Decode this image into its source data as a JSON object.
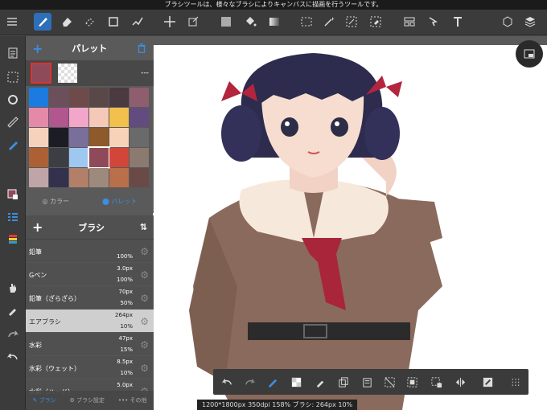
{
  "tooltip": "ブラシツールは、様々なブラシによりキャンバスに描画を行うツールです。",
  "palette": {
    "title": "パレット",
    "current_value": "---",
    "tabs": [
      "カラー",
      "パレット"
    ],
    "swatches": [
      "#1b7be0",
      "#6b4f5a",
      "#6e4a4a",
      "#5a4747",
      "#4b3a3f",
      "#8f5e6e",
      "#e589a8",
      "#b1568e",
      "#f2a6c9",
      "#f5c9b7",
      "#f2c04c",
      "#624b7f",
      "#f6d2bd",
      "#1c1c24",
      "#7a6e9a",
      "#8e5a2c",
      "#f7d2b8",
      "#6a6a6a",
      "#ad6036",
      "#3d3d44",
      "#9ec8f0",
      "#8f4a5a",
      "#d2463a",
      "#8a7a70",
      "#bfa4a8",
      "#33314e",
      "#b28068",
      "#9e8a7c",
      "#b86f4a",
      "#6a4a47"
    ],
    "current_color": "#8f4a5a"
  },
  "brush": {
    "title": "ブラシ",
    "items": [
      {
        "name": "鉛筆",
        "size": "",
        "opacity": "100%"
      },
      {
        "name": "Gペン",
        "size": "3.0px",
        "opacity": "100%"
      },
      {
        "name": "鉛筆（ざらざら）",
        "size": "70px",
        "opacity": "50%"
      },
      {
        "name": "エアブラシ",
        "size": "264px",
        "opacity": "10%"
      },
      {
        "name": "水彩",
        "size": "47px",
        "opacity": "15%"
      },
      {
        "name": "水彩（ウェット）",
        "size": "8.5px",
        "opacity": "10%"
      },
      {
        "name": "水彩（ハード）",
        "size": "5.0px",
        "opacity": ""
      }
    ],
    "selected_index": 3,
    "tabs": [
      "ブラシ",
      "ブラシ設定",
      "その他"
    ]
  },
  "status": "1200*1800px 350dpi 158% ブラシ: 264px 10%",
  "colors": {
    "accent": "#2d6fb8",
    "toolbar": "#3b3b3b"
  }
}
